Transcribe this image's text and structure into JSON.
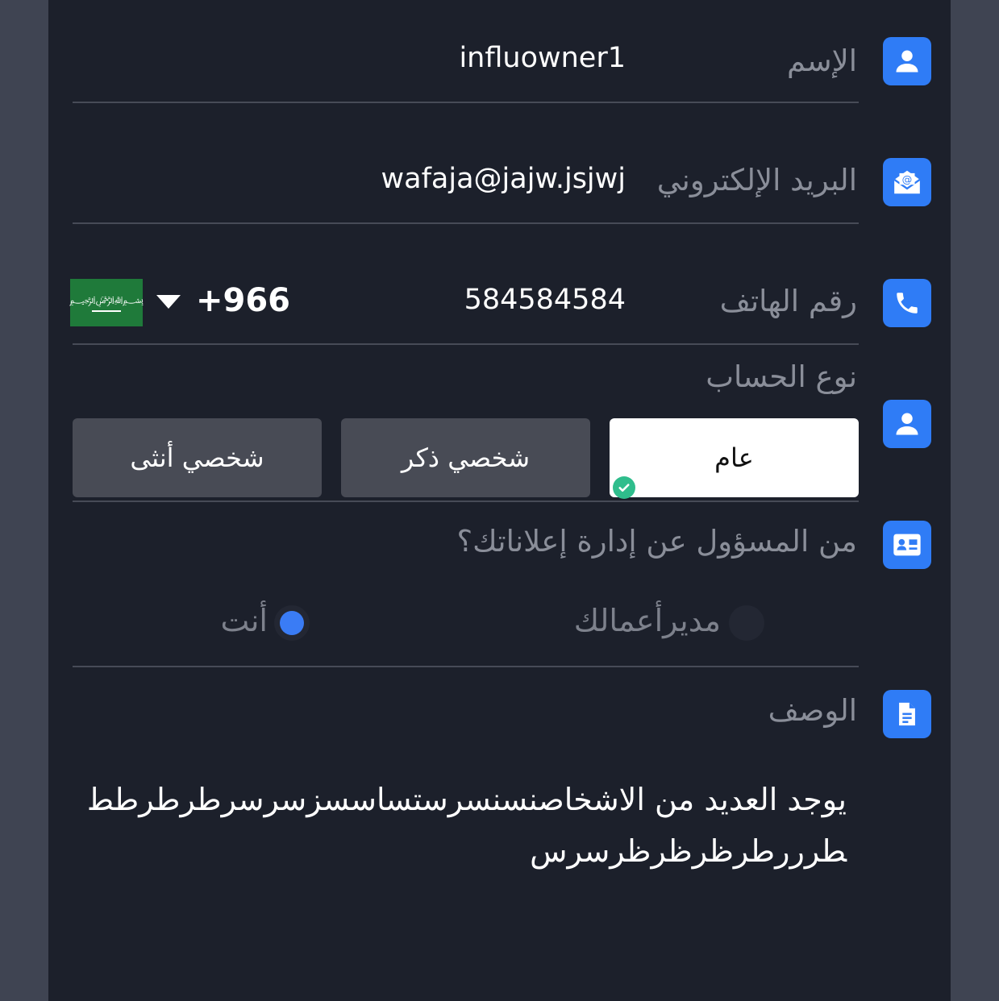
{
  "form": {
    "name": {
      "label": "الإسم",
      "value": "influowner1",
      "icon": "user-icon"
    },
    "email": {
      "label": "البريد الإلكتروني",
      "value": "wafaja@jajw.jsjwj",
      "icon": "email-icon"
    },
    "phone": {
      "label": "رقم الهاتف",
      "value": "584584584",
      "country_code": "+966",
      "flag": "saudi-arabia-flag",
      "icon": "phone-icon"
    },
    "account_type": {
      "label": "نوع الحساب",
      "icon": "user-icon",
      "options": [
        "عام",
        "شخصي ذكر",
        "شخصي أنثى"
      ],
      "selected": "عام"
    },
    "ads_manager": {
      "label": "من المسؤول عن إدارة إعلاناتك؟",
      "icon": "contact-card-icon",
      "options": [
        "مديرأعمالك",
        "أنت"
      ],
      "selected": "أنت"
    },
    "description": {
      "label": "الوصف",
      "icon": "document-icon",
      "value": "يوجد العديد من الاشخاصنسنسرستساسسزسرسرطرطرطططرررطرظرظرظرسرس"
    }
  },
  "colors": {
    "background": "#1c202b",
    "accent": "#2f7cf6",
    "label": "#8a8e99",
    "check": "#2fbd8c"
  }
}
